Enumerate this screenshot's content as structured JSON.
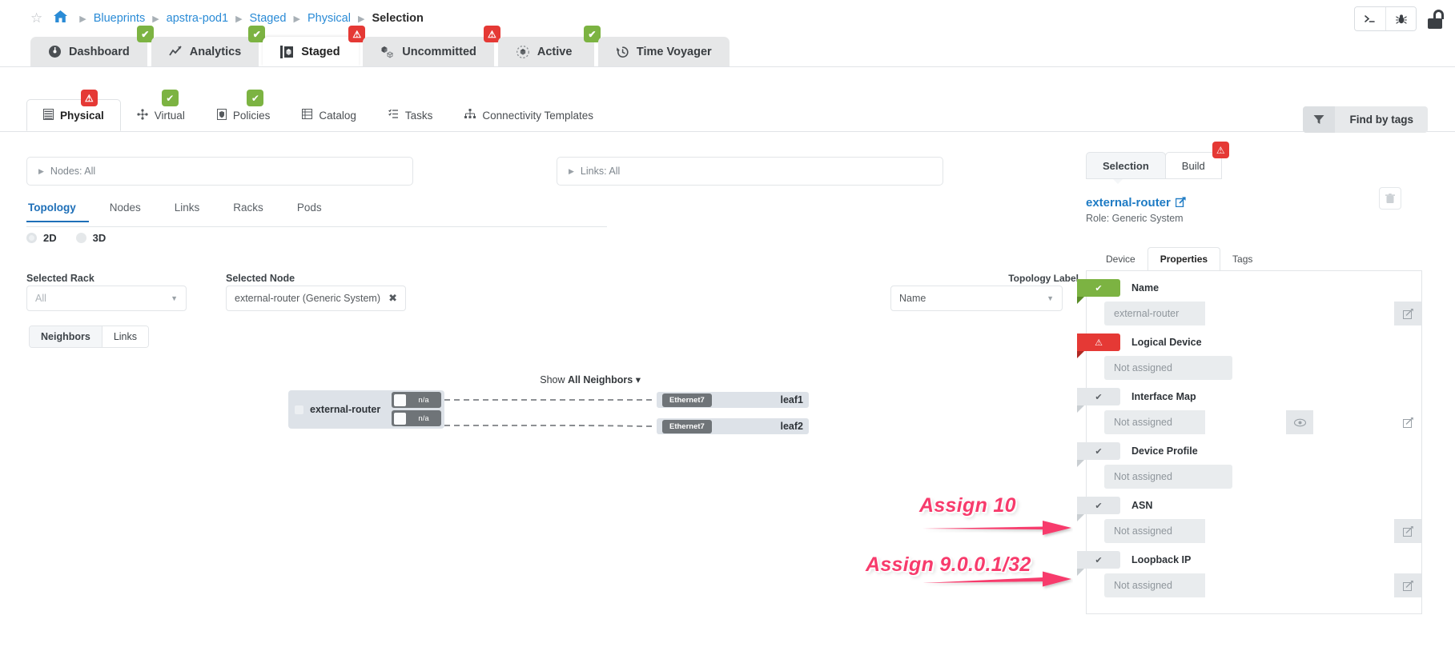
{
  "breadcrumb": {
    "star_icon": "star-outline-icon",
    "home_icon": "home-icon",
    "items": [
      "Blueprints",
      "apstra-pod1",
      "Staged",
      "Physical"
    ],
    "current": "Selection"
  },
  "topbar": {
    "console_icon": ">_",
    "bug_icon": "bug-icon",
    "lock_icon": "unlocked-padlock-icon"
  },
  "main_tabs": [
    {
      "label": "Dashboard",
      "icon": "gauge-icon",
      "badge": "ok",
      "active": false
    },
    {
      "label": "Analytics",
      "icon": "chart-line-icon",
      "badge": "ok",
      "active": false
    },
    {
      "label": "Staged",
      "icon": "box-stage-icon",
      "badge": "warn",
      "active": true
    },
    {
      "label": "Uncommitted",
      "icon": "cubes-icon",
      "badge": "warn",
      "active": false
    },
    {
      "label": "Active",
      "icon": "active-node-icon",
      "badge": "ok",
      "active": false
    },
    {
      "label": "Time Voyager",
      "icon": "clock-rewind-icon",
      "badge": null,
      "active": false
    }
  ],
  "sub_tabs": [
    {
      "label": "Physical",
      "icon": "server-rack-icon",
      "badge": "warn",
      "active": true
    },
    {
      "label": "Virtual",
      "icon": "virtual-net-icon",
      "badge": "ok",
      "active": false
    },
    {
      "label": "Policies",
      "icon": "shield-icon",
      "badge": "ok",
      "active": false
    },
    {
      "label": "Catalog",
      "icon": "catalog-icon",
      "badge": null,
      "active": false
    },
    {
      "label": "Tasks",
      "icon": "tasks-list-icon",
      "badge": null,
      "active": false
    },
    {
      "label": "Connectivity Templates",
      "icon": "connectivity-icon",
      "badge": null,
      "active": false
    }
  ],
  "find_by_tags": {
    "label": "Find by tags",
    "icon": "filter-funnel-icon"
  },
  "filters": {
    "nodes": "Nodes: All",
    "links": "Links: All"
  },
  "view_tabs": [
    {
      "label": "Topology",
      "active": true
    },
    {
      "label": "Nodes",
      "active": false
    },
    {
      "label": "Links",
      "active": false
    },
    {
      "label": "Racks",
      "active": false
    },
    {
      "label": "Pods",
      "active": false
    }
  ],
  "dimension_radios": [
    {
      "label": "2D",
      "selected": true
    },
    {
      "label": "3D",
      "selected": false
    }
  ],
  "selectors": {
    "rack_label": "Selected Rack",
    "rack_value": "All",
    "node_label": "Selected Node",
    "node_value": "external-router (Generic System)",
    "node_clear_icon": "close-x-icon",
    "topology_label": "Topology Label",
    "topology_value": "Name"
  },
  "neighbors_toggle": [
    {
      "label": "Neighbors",
      "active": true
    },
    {
      "label": "Links",
      "active": false
    }
  ],
  "graph": {
    "show_neighbors_prefix": "Show ",
    "show_neighbors_bold": "All Neighbors",
    "show_neighbors_caret": "▾",
    "source": {
      "name": "external-router",
      "interfaces": [
        "n/a",
        "n/a"
      ]
    },
    "neighbors": [
      {
        "interface": "Ethernet7",
        "name": "leaf1"
      },
      {
        "interface": "Ethernet7",
        "name": "leaf2"
      }
    ]
  },
  "right_panel": {
    "tabs": [
      {
        "label": "Selection",
        "active": true,
        "badge": null
      },
      {
        "label": "Build",
        "active": false,
        "badge": "warn"
      }
    ],
    "node_name": "external-router",
    "external_link_icon": "external-link-icon",
    "role": "Role: Generic System",
    "delete_icon": "trash-icon",
    "property_tabs": [
      {
        "label": "Device",
        "active": false
      },
      {
        "label": "Properties",
        "active": true
      },
      {
        "label": "Tags",
        "active": false
      }
    ],
    "properties": [
      {
        "title": "Name",
        "value": "external-router",
        "status": "green",
        "status_icon": "check-circle-icon",
        "buttons": [
          "edit-pencil-icon"
        ]
      },
      {
        "title": "Logical Device",
        "value": "Not assigned",
        "status": "red",
        "status_icon": "warning-triangle-icon",
        "buttons": []
      },
      {
        "title": "Interface Map",
        "value": "Not assigned",
        "status": "grey",
        "status_icon": "check-circle-icon",
        "buttons": [
          "eye-icon",
          "edit-pencil-icon"
        ]
      },
      {
        "title": "Device Profile",
        "value": "Not assigned",
        "status": "grey",
        "status_icon": "check-circle-icon",
        "buttons": []
      },
      {
        "title": "ASN",
        "value": "Not assigned",
        "status": "grey",
        "status_icon": "check-circle-icon",
        "buttons": [
          "edit-pencil-icon"
        ]
      },
      {
        "title": "Loopback IP",
        "value": "Not assigned",
        "status": "grey",
        "status_icon": "check-circle-icon",
        "buttons": [
          "edit-pencil-icon"
        ]
      }
    ]
  },
  "annotations": [
    {
      "text": "Assign 10",
      "color": "#f73b6c"
    },
    {
      "text": "Assign 9.0.0.1/32",
      "color": "#f73b6c"
    }
  ],
  "colors": {
    "link_blue": "#2a8bd6",
    "ok_green": "#7cb342",
    "warn_red": "#e53935",
    "accent_pink": "#f73b6c"
  }
}
